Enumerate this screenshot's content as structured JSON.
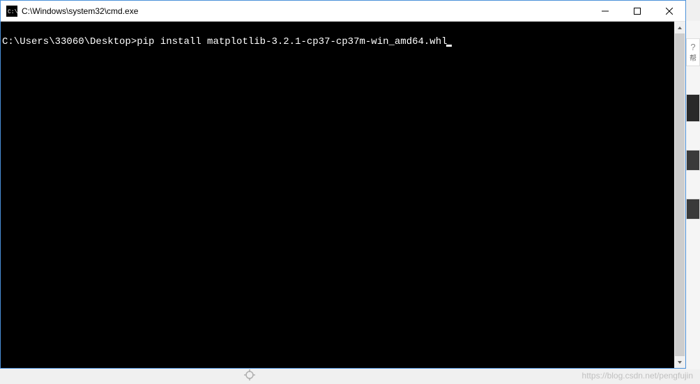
{
  "window": {
    "title": "C:\\Windows\\system32\\cmd.exe"
  },
  "terminal": {
    "prompt": "C:\\Users\\33060\\Desktop>",
    "command": "pip install matplotlib-3.2.1-cp37-cp37m-win_amd64.whl"
  },
  "sidebar": {
    "help_icon": "?",
    "help_label": "帮"
  },
  "watermark": "https://blog.csdn.net/pengfujin"
}
